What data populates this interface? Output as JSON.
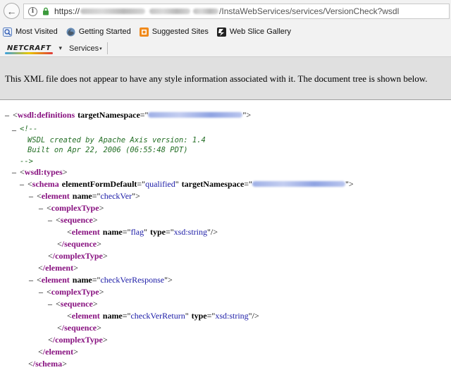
{
  "browser": {
    "url": {
      "prefix": "https://",
      "path": "/InstaWebServices/services/VersionCheck?wsdl"
    },
    "bookmarks": [
      {
        "label": "Most Visited",
        "icon": "most-visited-icon"
      },
      {
        "label": "Getting Started",
        "icon": "firefox-icon"
      },
      {
        "label": "Suggested Sites",
        "icon": "suggested-sites-icon"
      },
      {
        "label": "Web Slice Gallery",
        "icon": "web-slice-icon"
      }
    ],
    "netcraft": {
      "logo": "NETCRAFT",
      "services_label": "Services"
    }
  },
  "xml_viewer": {
    "banner": "This XML file does not appear to have any style information associated with it. The document tree is shown below.",
    "lines": {
      "l1_tag": "wsdl:definitions",
      "l1_attr": "targetNamespace",
      "c1": "<!--",
      "c2": "WSDL created by Apache Axis version: 1.4",
      "c3": "Built on Apr 22, 2006 (06:55:48 PDT)",
      "c4": "-->",
      "l2_tag": "wsdl:types",
      "l3_tag": "schema",
      "l3_attr1": "elementFormDefault",
      "l3_val1": "qualified",
      "l3_attr2": "targetNamespace",
      "l4_tag": "element",
      "l4_attr": "name",
      "l4_val": "checkVer",
      "l5_tag": "complexType",
      "l6_tag": "sequence",
      "l7_tag": "element",
      "l7_attr1": "name",
      "l7_val1": "flag",
      "l7_attr2": "type",
      "l7_val2": "xsd:string",
      "l8_tag": "/sequence",
      "l9_tag": "/complexType",
      "l10_tag": "/element",
      "l11_tag": "element",
      "l11_attr": "name",
      "l11_val": "checkVerResponse",
      "l12_tag": "complexType",
      "l13_tag": "sequence",
      "l14_tag": "element",
      "l14_attr1": "name",
      "l14_val1": "checkVerReturn",
      "l14_attr2": "type",
      "l14_val2": "xsd:string",
      "l15_tag": "/sequence",
      "l16_tag": "/complexType",
      "l17_tag": "/element",
      "l18_tag": "/schema"
    }
  },
  "colors": {
    "tag": "#881280",
    "value": "#1a1aa6",
    "comment": "#236e25",
    "banner_bg": "#e0e0e0"
  }
}
